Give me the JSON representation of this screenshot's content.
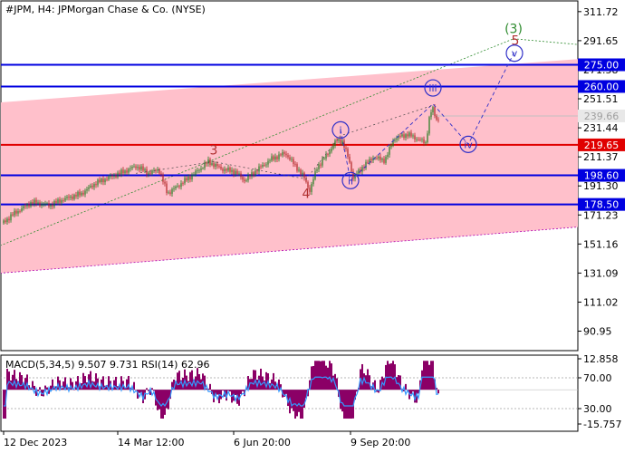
{
  "chart_data": [
    {
      "type": "candlestick",
      "title": "#JPM, H4:  JPMorgan Chase & Co. (NYSE)",
      "ylim": [
        80,
        316
      ],
      "y_ticks": [
        "311.72",
        "291.65",
        "271.58",
        "251.51",
        "231.44",
        "211.37",
        "191.30",
        "171.23",
        "151.16",
        "131.09",
        "111.02",
        "90.95"
      ],
      "x_ticks": [
        "12 Dec 2023",
        "14 Mar 12:00",
        "6 Jun 20:00",
        "9 Sep 20:00"
      ],
      "last_price": "239.66",
      "levels": [
        {
          "label": "275.00",
          "value": 275.0,
          "color": "#0000e0"
        },
        {
          "label": "260.00",
          "value": 260.0,
          "color": "#0000e0"
        },
        {
          "label": "219.65",
          "value": 219.65,
          "color": "#e00000"
        },
        {
          "label": "198.60",
          "value": 198.6,
          "color": "#0000e0"
        },
        {
          "label": "178.50",
          "value": 178.5,
          "color": "#0000e0"
        }
      ],
      "channel": {
        "upper": [
          [
            0,
            249
          ],
          [
            640,
            279
          ]
        ],
        "lower": [
          [
            0,
            131
          ],
          [
            640,
            163
          ]
        ],
        "color": "#ffc0cb"
      },
      "price_path": [
        [
          0,
          164
        ],
        [
          15,
          172
        ],
        [
          35,
          180
        ],
        [
          55,
          178
        ],
        [
          70,
          182
        ],
        [
          90,
          186
        ],
        [
          105,
          193
        ],
        [
          120,
          197
        ],
        [
          140,
          202
        ],
        [
          150,
          205
        ],
        [
          165,
          200
        ],
        [
          175,
          203
        ],
        [
          185,
          186
        ],
        [
          200,
          193
        ],
        [
          215,
          200
        ],
        [
          230,
          208
        ],
        [
          245,
          203
        ],
        [
          260,
          201
        ],
        [
          270,
          195
        ],
        [
          285,
          203
        ],
        [
          300,
          210
        ],
        [
          315,
          214
        ],
        [
          325,
          206
        ],
        [
          335,
          198
        ],
        [
          342,
          188
        ],
        [
          350,
          204
        ],
        [
          360,
          212
        ],
        [
          372,
          223
        ],
        [
          378,
          222
        ],
        [
          385,
          210
        ],
        [
          390,
          197
        ],
        [
          400,
          204
        ],
        [
          412,
          211
        ],
        [
          425,
          209
        ],
        [
          435,
          224
        ],
        [
          450,
          227
        ],
        [
          460,
          224
        ],
        [
          470,
          221
        ],
        [
          475,
          242
        ],
        [
          478,
          244
        ],
        [
          482,
          237
        ],
        [
          485,
          238
        ]
      ],
      "wave_labels": [
        {
          "text": "(3)",
          "x": 567,
          "y": 300,
          "color": "#2e8b2e",
          "circle": false
        },
        {
          "text": "5",
          "x": 569,
          "y": 292,
          "color": "#b03030",
          "circle": false
        },
        {
          "text": "3",
          "x": 236,
          "y": 216,
          "color": "#b03030",
          "circle": false
        },
        {
          "text": "4",
          "x": 338,
          "y": 186,
          "color": "#b03030",
          "circle": false
        },
        {
          "text": "i",
          "x": 376,
          "y": 230,
          "color": "#3030c8",
          "circle": true
        },
        {
          "text": "ii",
          "x": 387,
          "y": 195,
          "color": "#3030c8",
          "circle": true
        },
        {
          "text": "iii",
          "x": 478,
          "y": 259,
          "color": "#3030c8",
          "circle": true
        },
        {
          "text": "iv",
          "x": 517,
          "y": 220,
          "color": "#3030c8",
          "circle": true
        },
        {
          "text": "v",
          "x": 568,
          "y": 283,
          "color": "#3030c8",
          "circle": true
        }
      ]
    },
    {
      "type": "histogram",
      "title": "MACD(5,34,5) 9.507 9.731 RSI(14) 62.96",
      "y_ticks": [
        "12.858",
        "70.00",
        "30.00",
        "-15.757"
      ]
    }
  ]
}
